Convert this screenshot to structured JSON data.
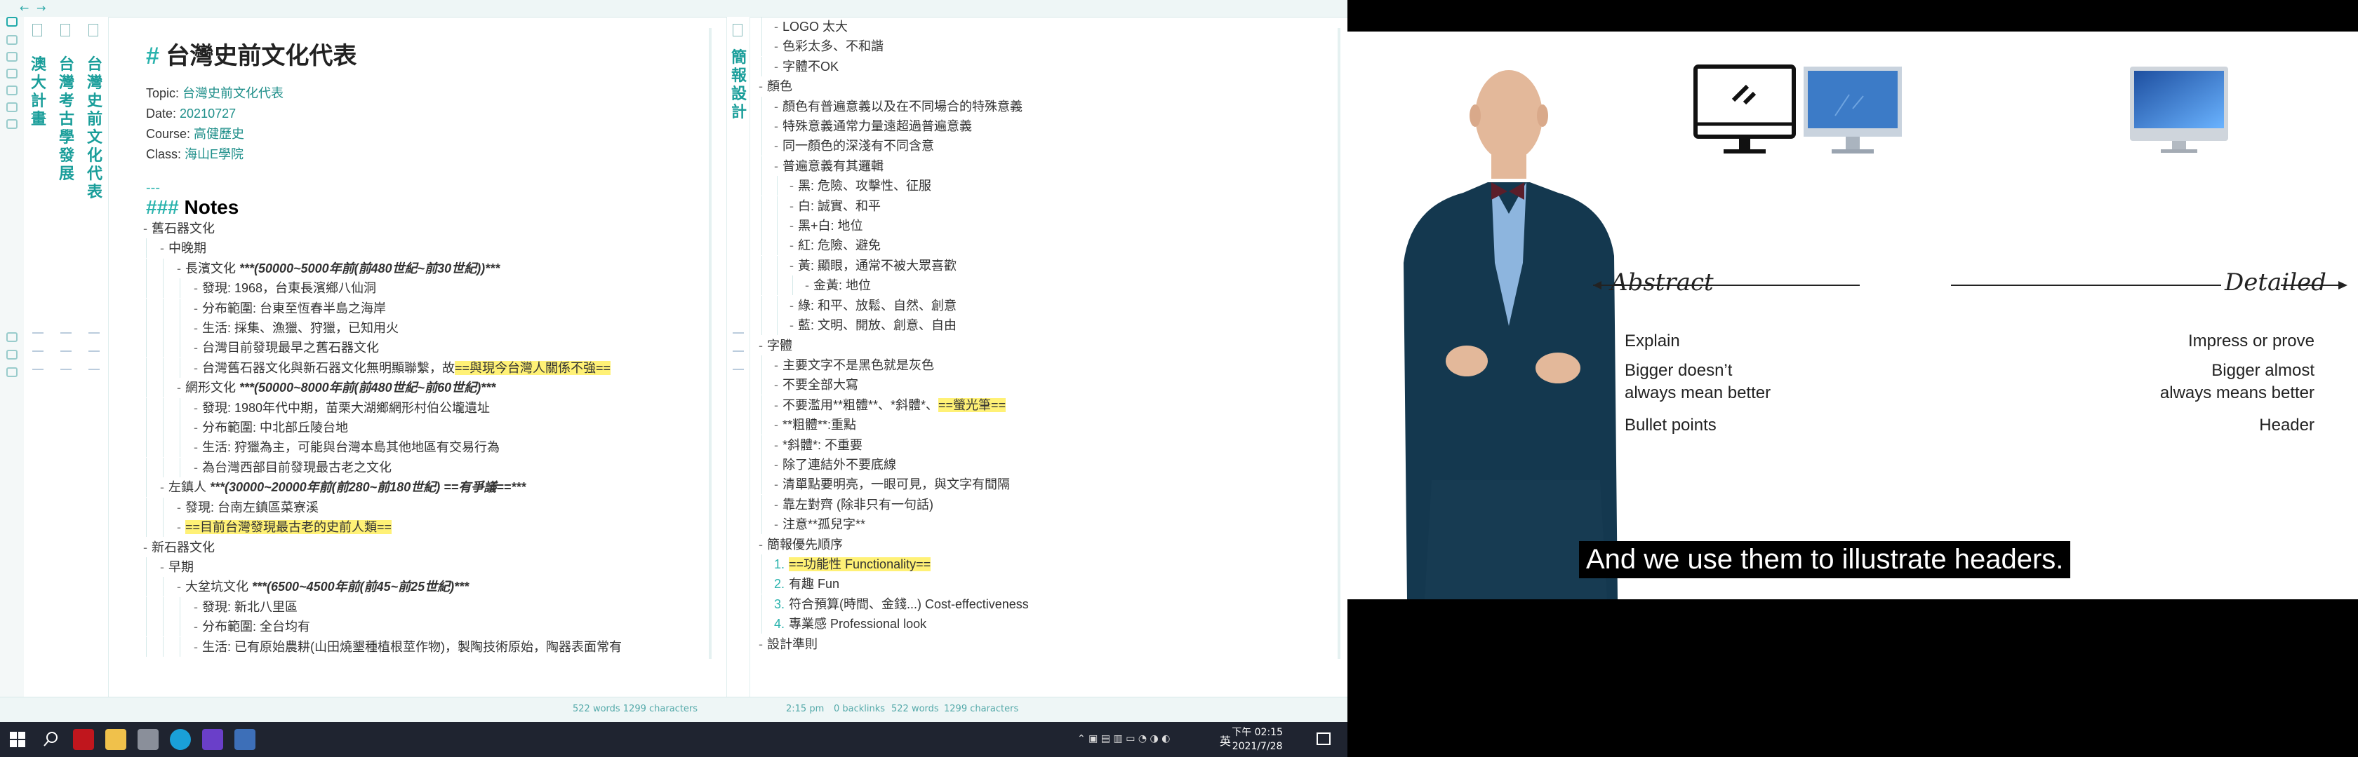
{
  "app": {
    "nav_back": "←",
    "nav_forward": "→",
    "stacked_titles": [
      "澳大計畫",
      "台灣考古學發展",
      "台灣史前文化代表"
    ],
    "right_tab_title": "簡報設計",
    "note": {
      "title": "台灣史前文化代表",
      "meta": [
        {
          "key": "Topic: ",
          "value": "台灣史前文化代表"
        },
        {
          "key": "Date: ",
          "value": "20210727"
        },
        {
          "key": "Course: ",
          "value": "高健歷史"
        },
        {
          "key": "Class: ",
          "value": "海山E學院"
        }
      ],
      "hr": "---",
      "notes_heading": "Notes",
      "lines": [
        {
          "t": "舊石器文化",
          "l": 0
        },
        {
          "t": "中晚期",
          "l": 1
        },
        {
          "t": "長濱文化 ",
          "b": "***(50000~5000年前(前480世紀~前30世紀))***",
          "l": 2
        },
        {
          "t": "發現: 1968，台東長濱鄉八仙洞",
          "l": 3
        },
        {
          "t": "分布範圍: 台東至恆春半島之海岸",
          "l": 3
        },
        {
          "t": "生活: 採集、漁獵、狩獵，已知用火",
          "l": 3
        },
        {
          "t": "台灣目前發現最早之舊石器文化",
          "l": 3
        },
        {
          "t": "台灣舊石器文化與新石器文化無明顯聯繫，故",
          "h": "==與現今台灣人關係不強==",
          "l": 3
        },
        {
          "t": "網形文化 ",
          "b": "***(50000~8000年前(前480世紀~前60世紀)***",
          "l": 2
        },
        {
          "t": "發現: 1980年代中期，苗栗大湖鄉網形村伯公壠遺址",
          "l": 3
        },
        {
          "t": "分布範圍: 中北部丘陵台地",
          "l": 3
        },
        {
          "t": "生活: 狩獵為主，可能與台灣本島其他地區有交易行為",
          "l": 3
        },
        {
          "t": "為台灣西部目前發現最古老之文化",
          "l": 3
        },
        {
          "t": "左鎮人 ",
          "b": "***(30000~20000年前(前280~前180世紀) ==有爭議==***",
          "l": 1
        },
        {
          "t": "發現: 台南左鎮區菜寮溪",
          "l": 2
        },
        {
          "t": "",
          "h": "==目前台灣發現最古老的史前人類==",
          "l": 2
        },
        {
          "t": "新石器文化",
          "l": 0
        },
        {
          "t": "早期",
          "l": 1
        },
        {
          "t": "大坌坑文化 ",
          "b": "***(6500~4500年前(前45~前25世紀)***",
          "l": 2
        },
        {
          "t": "發現: 新北八里區",
          "l": 3
        },
        {
          "t": "分布範圍: 全台均有",
          "l": 3
        },
        {
          "t": "生活: 已有原始農耕(山田燒墾種植根莖作物)，製陶技術原始，陶器表面常有",
          "l": 3
        }
      ]
    },
    "outline": {
      "lines": [
        {
          "t": "LOGO 太大",
          "l": 1
        },
        {
          "t": "色彩太多、不和諧",
          "l": 1
        },
        {
          "t": "字體不OK",
          "l": 1
        },
        {
          "t": "顏色",
          "l": 0
        },
        {
          "t": "顏色有普遍意義以及在不同場合的特殊意義",
          "l": 1
        },
        {
          "t": "特殊意義通常力量遠超過普遍意義",
          "l": 1
        },
        {
          "t": "同一顏色的深淺有不同含意",
          "l": 1
        },
        {
          "t": "普遍意義有其邏輯",
          "l": 1
        },
        {
          "t": "黑: 危險、攻擊性、征服",
          "l": 2
        },
        {
          "t": "白: 誠實、和平",
          "l": 2
        },
        {
          "t": "黑+白: 地位",
          "l": 2
        },
        {
          "t": "紅: 危險、避免",
          "l": 2
        },
        {
          "t": "黃: 顯眼，通常不被大眾喜歡",
          "l": 2
        },
        {
          "t": "金黃: 地位",
          "l": 3
        },
        {
          "t": "綠: 和平、放鬆、自然、創意",
          "l": 2
        },
        {
          "t": "藍: 文明、開放、創意、自由",
          "l": 2
        },
        {
          "t": "字體",
          "l": 0
        },
        {
          "t": "主要文字不是黑色就是灰色",
          "l": 1
        },
        {
          "t": "不要全部大寫",
          "l": 1
        },
        {
          "t": "不要濫用**粗體**、*斜體*、",
          "h": "==螢光筆==",
          "l": 1
        },
        {
          "t": "**粗體**:重點",
          "l": 1
        },
        {
          "t": "*斜體*: 不重要",
          "l": 1
        },
        {
          "t": "除了連結外不要底線",
          "l": 1
        },
        {
          "t": "清單點要明亮，一眼可見，與文字有間隔",
          "l": 1
        },
        {
          "t": "靠左對齊 (除非只有一句話)",
          "l": 1
        },
        {
          "t": "注意**孤兒字**",
          "l": 1
        },
        {
          "t": "簡報優先順序",
          "l": 0
        },
        {
          "t": "",
          "h": "==功能性 Functionality==",
          "l": 1,
          "n": "1."
        },
        {
          "t": "有趣 Fun",
          "l": 1,
          "n": "2."
        },
        {
          "t": "符合預算(時間、金錢...) Cost-effectiveness",
          "l": 1,
          "n": "3."
        },
        {
          "t": "專業感 Professional look",
          "l": 1,
          "n": "4."
        },
        {
          "t": "設計準則",
          "l": 0
        }
      ]
    },
    "status": {
      "left": "522 words 1299 characters",
      "time": "2:15 pm",
      "backlinks": "0 backlinks",
      "words": "522 words",
      "chars": "1299 characters"
    }
  },
  "taskbar": {
    "lang": "英",
    "time": "下午 02:15",
    "date": "2021/7/28"
  },
  "video": {
    "abstract": "Abstract",
    "detailed": "Detailed",
    "left_items": [
      "Explain",
      "Bigger doesn’t\nalways mean better",
      "Bullet points"
    ],
    "right_items": [
      "Impress or prove",
      "Bigger almost\nalways means better",
      "Header"
    ],
    "subtitle": "And we use them to illustrate headers."
  }
}
